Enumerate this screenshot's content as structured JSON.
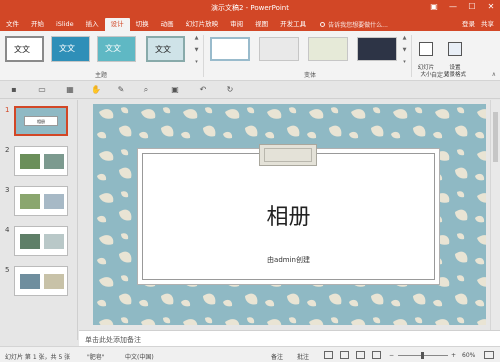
{
  "window": {
    "title": "演示文稿2 - PowerPoint",
    "controls": [
      "▣",
      "—",
      "☐",
      "✕"
    ]
  },
  "tabs": [
    "文件",
    "开始",
    "iSlide",
    "插入",
    "设计",
    "切换",
    "动画",
    "幻灯片放映",
    "审阅",
    "视图",
    "开发工具"
  ],
  "active_tab": "设计",
  "tell_me": "告诉我您想要做什么...",
  "account": {
    "login": "登录",
    "share": "共享"
  },
  "ribbon": {
    "themes_label": "主题",
    "variants_label": "变体",
    "customize_label": "自定义",
    "theme_thumb_text": "文文",
    "slide_size_label": "幻灯片\n大小",
    "format_bg_label": "设置\n背景格式"
  },
  "slides": [
    {
      "num": "1",
      "type": "title",
      "mini_text": "相册"
    },
    {
      "num": "2",
      "type": "photos"
    },
    {
      "num": "3",
      "type": "photos"
    },
    {
      "num": "4",
      "type": "photos"
    },
    {
      "num": "5",
      "type": "photos"
    }
  ],
  "slide": {
    "title": "相册",
    "subtitle": "由admin创建"
  },
  "notes_placeholder": "单击此处添加备注",
  "status": {
    "slide_info": "幻灯片 第 1 张，共 5 张",
    "theme": "\"肥皂\"",
    "language": "中文(中国)",
    "notes_btn": "备注",
    "comments_btn": "批注",
    "zoom": "60%"
  },
  "colors": {
    "accent": "#d24726",
    "slide_bg": "#8fb9c4"
  }
}
